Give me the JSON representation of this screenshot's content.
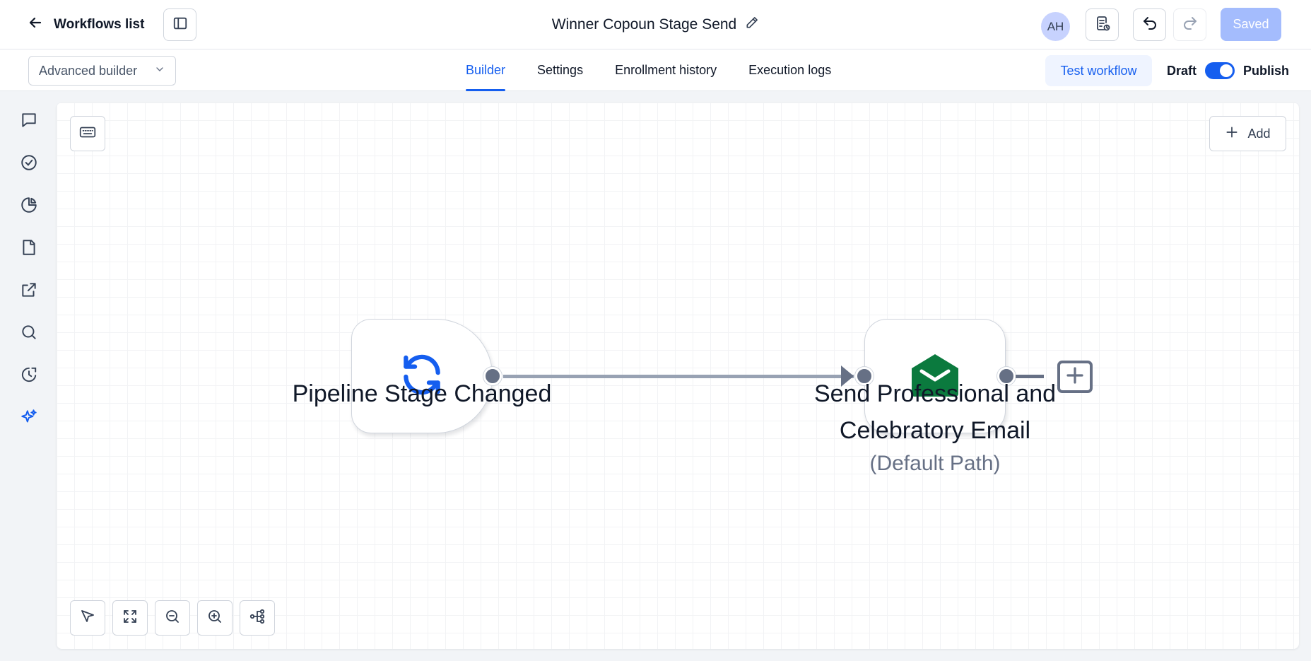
{
  "header": {
    "back_label": "Workflows list",
    "title": "Winner Copoun Stage Send",
    "avatar_initials": "AH",
    "saved_label": "Saved"
  },
  "subbar": {
    "builder_mode": "Advanced builder",
    "tabs": [
      {
        "label": "Builder",
        "active": true
      },
      {
        "label": "Settings",
        "active": false
      },
      {
        "label": "Enrollment history",
        "active": false
      },
      {
        "label": "Execution logs",
        "active": false
      }
    ],
    "test_label": "Test workflow",
    "draft_label": "Draft",
    "publish_label": "Publish",
    "publish_on": true
  },
  "rail": {
    "icons": [
      "chat-icon",
      "check-circle-icon",
      "pie-chart-icon",
      "file-icon",
      "external-link-icon",
      "search-icon",
      "history-icon",
      "sparkle-icon"
    ]
  },
  "canvas": {
    "add_label": "Add",
    "nodes": [
      {
        "kind": "trigger",
        "label": "Pipeline Stage Changed",
        "icon": "refresh-icon",
        "icon_color": "#155eef"
      },
      {
        "kind": "action",
        "label_line1": "Send Professional and",
        "label_line2": "Celebratory Email",
        "sublabel": "(Default Path)",
        "icon": "mail-open-icon",
        "icon_color": "#0b7a3e"
      }
    ]
  },
  "colors": {
    "accent": "#155eef",
    "saved_button": "#a4bcfd",
    "connector": "#667085",
    "email_icon": "#0b7a3e"
  }
}
